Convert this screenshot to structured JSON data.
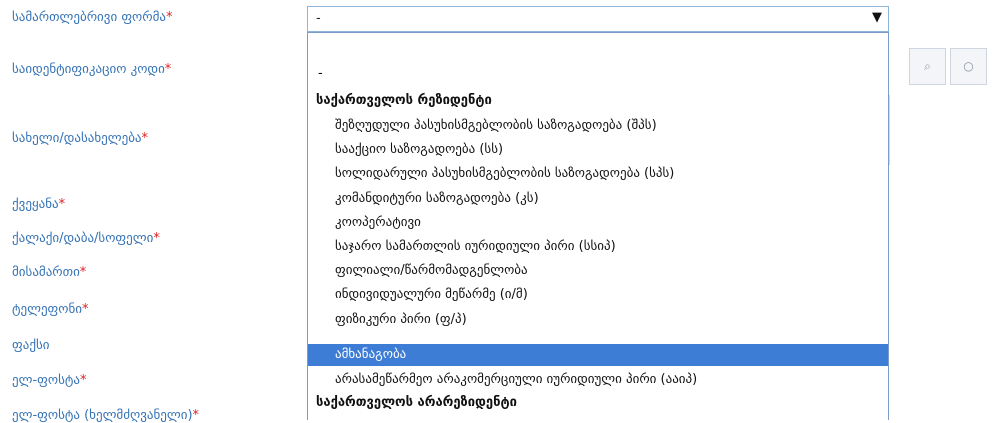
{
  "labels": [
    {
      "text": "სამართლებრივი ფორმა",
      "required": "*"
    },
    {
      "text": "საიდენტიფიკაციო კოდი",
      "required": "*"
    },
    {
      "text": "სახელი/დასახელება",
      "required": "*"
    },
    {
      "text": "ქვეყანა",
      "required": "*"
    },
    {
      "text": "ქალაქი/დაბა/სოფელი",
      "required": "*"
    },
    {
      "text": "მისამართი",
      "required": "*"
    },
    {
      "text": "ტელეფონი",
      "required": "*"
    },
    {
      "text": "ფაქსი",
      "required": ""
    },
    {
      "text": "ელ-ფოსტა",
      "required": "*"
    },
    {
      "text": "ელ-ფოსტა (ხელმძღვანელი)",
      "required": "*"
    }
  ],
  "select": {
    "value": "-",
    "arrow": "▼"
  },
  "buttons": {
    "search_glyph": "⌕",
    "clear_glyph": "○"
  },
  "options": {
    "dash": "-",
    "group_resident": "საქართველოს რეზიდენტი",
    "items": [
      "შეზღუდული პასუხისმგებლობის საზოგადოება (შპს)",
      "სააქციო საზოგადოება (სს)",
      "სოლიდარული პასუხისმგებლობის საზოგადოება (სპს)",
      "კომანდიტური საზოგადოება (კს)",
      "კოოპერატივი",
      "საჯარო სამართლის იურიდიული პირი (სსიპ)",
      "ფილიალი/წარმომადგენლობა",
      "ინდივიდუალური მეწარმე (ი/მ)",
      "ფიზიკური პირი (ფ/პ)",
      "ამხანაგობა",
      "არასამეწარმეო არაკომერციული იურიდიული პირი (ააიპ)"
    ],
    "selected_index": 9,
    "group_nonresident": "საქართველოს არარეზიდენტი"
  },
  "colors": {
    "label": "#3573b6",
    "required": "#e02020",
    "selected": "#3d7dd6"
  }
}
